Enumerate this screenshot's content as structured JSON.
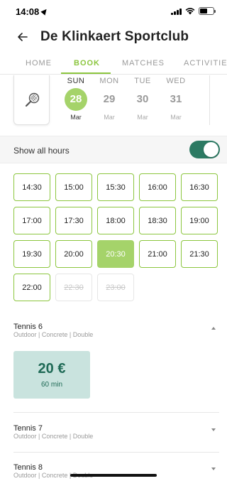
{
  "status": {
    "time": "14:08"
  },
  "header": {
    "title": "De Klinkaert Sportclub"
  },
  "tabs": [
    {
      "label": "HOME",
      "active": false
    },
    {
      "label": "BOOK",
      "active": true
    },
    {
      "label": "MATCHES",
      "active": false
    },
    {
      "label": "ACTIVITIES",
      "active": false
    }
  ],
  "dates": [
    {
      "day": "SUN",
      "num": "28",
      "month": "Mar",
      "selected": true
    },
    {
      "day": "MON",
      "num": "29",
      "month": "Mar",
      "selected": false
    },
    {
      "day": "TUE",
      "num": "30",
      "month": "Mar",
      "selected": false
    },
    {
      "day": "WED",
      "num": "31",
      "month": "Mar",
      "selected": false
    }
  ],
  "hours": {
    "label": "Show all hours",
    "enabled": true
  },
  "slots": [
    {
      "time": "14:30",
      "state": "available"
    },
    {
      "time": "15:00",
      "state": "available"
    },
    {
      "time": "15:30",
      "state": "available"
    },
    {
      "time": "16:00",
      "state": "available"
    },
    {
      "time": "16:30",
      "state": "available"
    },
    {
      "time": "17:00",
      "state": "available"
    },
    {
      "time": "17:30",
      "state": "available"
    },
    {
      "time": "18:00",
      "state": "available"
    },
    {
      "time": "18:30",
      "state": "available"
    },
    {
      "time": "19:00",
      "state": "available"
    },
    {
      "time": "19:30",
      "state": "available"
    },
    {
      "time": "20:00",
      "state": "available"
    },
    {
      "time": "20:30",
      "state": "selected"
    },
    {
      "time": "21:00",
      "state": "available"
    },
    {
      "time": "21:30",
      "state": "available"
    },
    {
      "time": "22:00",
      "state": "available"
    },
    {
      "time": "22:30",
      "state": "disabled"
    },
    {
      "time": "23:00",
      "state": "disabled"
    }
  ],
  "courts": [
    {
      "name": "Tennis 6",
      "info": "Outdoor | Concrete | Double",
      "expanded": true
    },
    {
      "name": "Tennis 7",
      "info": "Outdoor | Concrete | Double",
      "expanded": false
    },
    {
      "name": "Tennis 8",
      "info": "Outdoor | Concrete | Double",
      "expanded": false
    }
  ],
  "price": {
    "amount": "20 €",
    "duration": "60 min"
  },
  "colors": {
    "accent": "#8cc63f",
    "toggle": "#2c7a63",
    "price_bg": "#c9e3de",
    "price_text": "#1f6a56"
  }
}
